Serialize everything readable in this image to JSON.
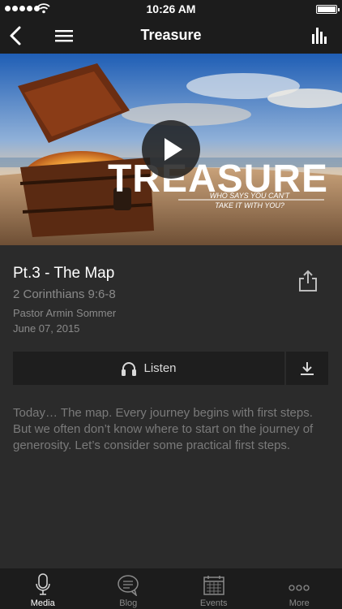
{
  "status_bar": {
    "time": "10:26 AM"
  },
  "nav": {
    "title": "Treasure"
  },
  "hero": {
    "title": "TREASURE",
    "tagline_line1": "WHO SAYS YOU CAN'T",
    "tagline_line2": "TAKE IT WITH YOU?"
  },
  "sermon": {
    "title": "Pt.3 - The Map",
    "scripture": "2 Corinthians 9:6-8",
    "speaker": "Pastor Armin Sommer",
    "date": "June 07, 2015",
    "description": "Today… The map.  Every journey begins with first steps.  But we often don’t know where to start on the journey of generosity.  Let’s consider some practical first steps."
  },
  "actions": {
    "listen_label": "Listen"
  },
  "tabs": [
    {
      "label": "Media",
      "icon": "microphone-icon",
      "active": true
    },
    {
      "label": "Blog",
      "icon": "chat-bubble-icon",
      "active": false
    },
    {
      "label": "Events",
      "icon": "calendar-icon",
      "active": false
    },
    {
      "label": "More",
      "icon": "ellipsis-icon",
      "active": false
    }
  ],
  "colors": {
    "background": "#2b2b2b",
    "bar": "#1c1c1c",
    "muted_text": "#8a8a8a",
    "description_text": "#7a7a7a"
  }
}
